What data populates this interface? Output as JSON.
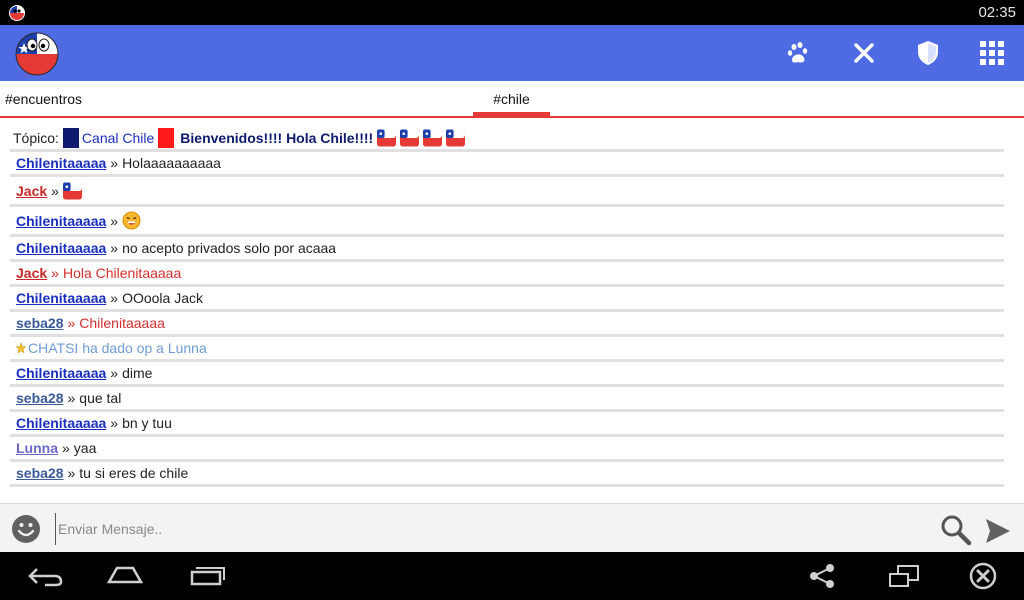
{
  "status_bar": {
    "time": "02:35"
  },
  "tabs": [
    {
      "label": "#encuentros"
    },
    {
      "label": "#chile"
    }
  ],
  "topic": {
    "label": "Tópico:",
    "channel": "Canal Chile",
    "message": "Bienvenidos!!!! Hola Chile!!!!"
  },
  "messages": [
    {
      "nick": "Chilenitaaaaa",
      "text": "Holaaaaaaaaaa"
    },
    {
      "nick": "Jack",
      "text": ""
    },
    {
      "nick": "Chilenitaaaaa",
      "text": ""
    },
    {
      "nick": "Chilenitaaaaa",
      "text": "no acepto privados solo por acaaa"
    },
    {
      "nick": "Jack",
      "text": "Hola Chilenitaaaaa"
    },
    {
      "nick": "Chilenitaaaaa",
      "text": "OOoola Jack"
    },
    {
      "nick": "seba28",
      "text": "Chilenitaaaaa"
    },
    {
      "nick": "",
      "text": "CHATSI ha dado op a Lunna"
    },
    {
      "nick": "Chilenitaaaaa",
      "text": "dime"
    },
    {
      "nick": "seba28",
      "text": "que tal"
    },
    {
      "nick": "Chilenitaaaaa",
      "text": "bn y tuu"
    },
    {
      "nick": "Lunna",
      "text": "yaa"
    },
    {
      "nick": "seba28",
      "text": "tu si eres de chile"
    }
  ],
  "separator": "»",
  "input": {
    "placeholder": "Enviar Mensaje.."
  },
  "colors": {
    "app_bar": "#4f6be3",
    "accent_red": "#e53935",
    "nick_blue": "#1a2fbf",
    "nick_red": "#c62828",
    "nick_steel": "#3b5a9a",
    "nick_lavender": "#6a68c9",
    "system_text": "#6f9bd6"
  },
  "icons": {
    "app_logo": "chile-flag-face-logo",
    "action_1": "paw-icon",
    "action_2": "close-icon",
    "action_3": "shield-icon",
    "action_4": "grid-menu-icon",
    "emoji": "smiley-icon",
    "search": "search-icon",
    "send": "send-icon",
    "nav_back": "back-icon",
    "nav_home": "home-icon",
    "nav_recents": "recents-icon",
    "nav_share": "share-icon",
    "nav_window": "window-icon",
    "nav_close": "circle-close-icon"
  }
}
